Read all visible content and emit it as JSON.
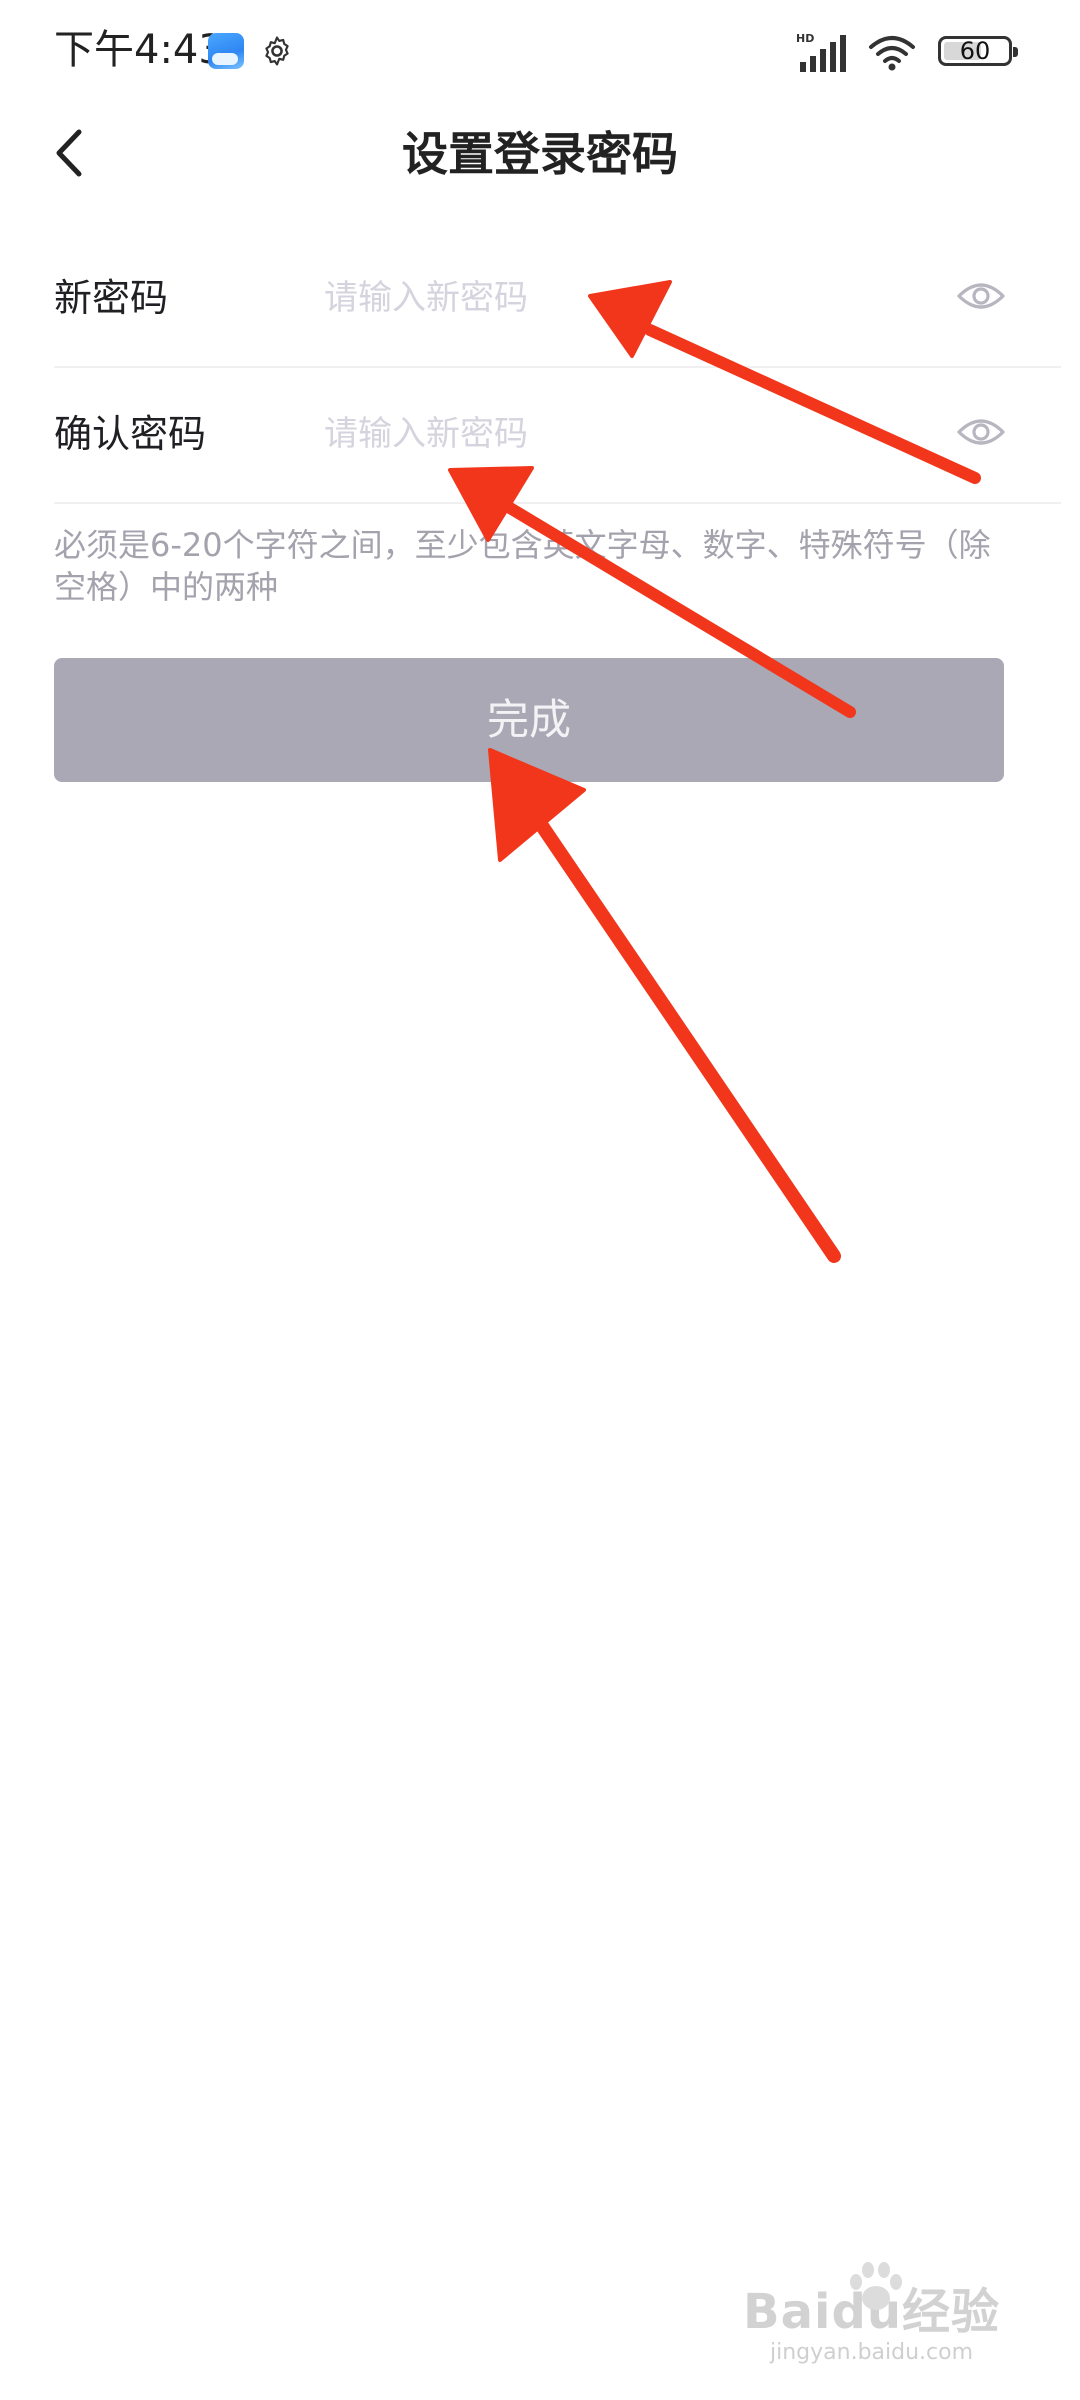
{
  "status_bar": {
    "time": "下午4:43",
    "battery": "60",
    "battery_level": 0.6,
    "network": "HD",
    "icons": [
      "weather-icon",
      "gear-icon",
      "signal-icon",
      "wifi-icon",
      "battery-icon"
    ]
  },
  "header": {
    "back_icon": "chevron-left-icon",
    "title": "设置登录密码"
  },
  "form": {
    "new_password": {
      "label": "新密码",
      "placeholder": "请输入新密码",
      "value": "",
      "toggle_icon": "eye-icon"
    },
    "confirm_password": {
      "label": "确认密码",
      "placeholder": "请输入新密码",
      "value": "",
      "toggle_icon": "eye-icon"
    },
    "hint": "必须是6-20个字符之间，至少包含英文字母、数字、特殊符号（除空格）中的两种"
  },
  "submit": {
    "label": "完成",
    "enabled": false
  },
  "watermark": {
    "logo": "Baidu经验",
    "url": "jingyan.baidu.com"
  },
  "colors": {
    "button_disabled": "#a9a8b4",
    "annotation_arrow": "#f2361b",
    "placeholder": "#d5d3dd",
    "hint": "#a4a2ad"
  }
}
